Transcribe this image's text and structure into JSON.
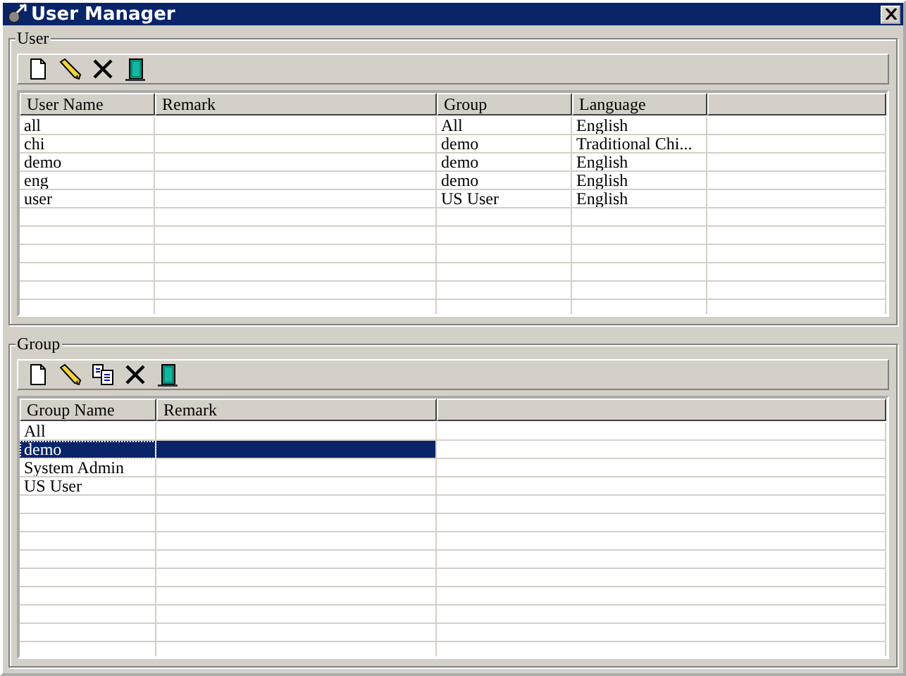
{
  "window": {
    "title": "User Manager"
  },
  "user_panel": {
    "title": "User",
    "tools": [
      {
        "kind": "new"
      },
      {
        "kind": "edit"
      },
      {
        "kind": "delete"
      },
      {
        "kind": "exit"
      }
    ],
    "columns": [
      "User Name",
      "Remark",
      "Group",
      "Language"
    ],
    "rows": [
      {
        "cells": [
          "all",
          "",
          "All",
          "English"
        ],
        "selected": false
      },
      {
        "cells": [
          "chi",
          "",
          "demo",
          "Traditional Chi..."
        ],
        "selected": false
      },
      {
        "cells": [
          "demo",
          "",
          "demo",
          "English"
        ],
        "selected": false
      },
      {
        "cells": [
          "eng",
          "",
          "demo",
          "English"
        ],
        "selected": false
      },
      {
        "cells": [
          "user",
          "",
          "US User",
          "English"
        ],
        "selected": false
      }
    ]
  },
  "group_panel": {
    "title": "Group",
    "tools": [
      {
        "kind": "new"
      },
      {
        "kind": "edit"
      },
      {
        "kind": "copy"
      },
      {
        "kind": "delete"
      },
      {
        "kind": "exit"
      }
    ],
    "columns": [
      "Group Name",
      "Remark"
    ],
    "rows": [
      {
        "cells": [
          "All",
          ""
        ],
        "selected": false
      },
      {
        "cells": [
          "demo",
          ""
        ],
        "selected": true
      },
      {
        "cells": [
          "System Admin",
          ""
        ],
        "selected": false
      },
      {
        "cells": [
          "US User",
          ""
        ],
        "selected": false
      }
    ]
  }
}
